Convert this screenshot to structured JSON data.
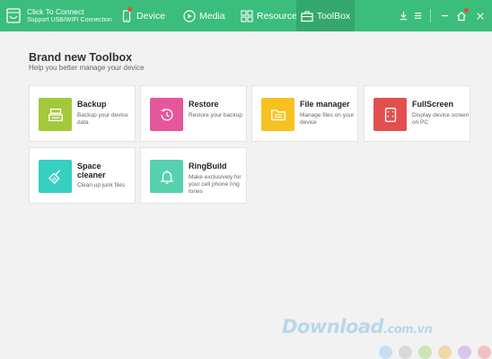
{
  "header": {
    "connect_title": "Click To Connect",
    "connect_subtitle": "Support USB/WIFI Connection",
    "tabs": [
      {
        "label": "Device",
        "icon": "phone-icon",
        "badge": true
      },
      {
        "label": "Media",
        "icon": "play-icon",
        "badge": false
      },
      {
        "label": "Resources",
        "icon": "grid-icon",
        "badge": false
      },
      {
        "label": "ToolBox",
        "icon": "toolbox-icon",
        "badge": false,
        "active": true
      }
    ],
    "controls": [
      "download-icon",
      "menu-icon",
      "minimize-icon",
      "home-icon",
      "close-icon"
    ]
  },
  "main": {
    "title": "Brand new Toolbox",
    "subtitle": "Help you better manage your device",
    "cards": [
      {
        "title": "Backup",
        "desc": "Backup your device data",
        "color": "#a3c93a",
        "icon": "backup-icon"
      },
      {
        "title": "Restore",
        "desc": "Restore your backup",
        "color": "#e5579d",
        "icon": "restore-icon"
      },
      {
        "title": "File manager",
        "desc": "Manage files on your device",
        "color": "#f6c21f",
        "icon": "folder-icon"
      },
      {
        "title": "FullScreen",
        "desc": "Display device screen on PC",
        "color": "#e14f4f",
        "icon": "fullscreen-icon"
      },
      {
        "title": "Space cleaner",
        "desc": "Clean up junk files",
        "color": "#36cfc2",
        "icon": "broom-icon"
      },
      {
        "title": "RingBuild",
        "desc": "Make exclusively for your cell phone ring tones",
        "color": "#56d1ae",
        "icon": "bell-icon"
      }
    ]
  },
  "watermark": {
    "text": "Download",
    "suffix": ".com.vn",
    "dot_colors": [
      "#c9dff0",
      "#d9d9d9",
      "#cfe3b6",
      "#f2d7a9",
      "#d5c8e6",
      "#f3c1c1"
    ]
  },
  "colors": {
    "header": "#3bbd7b",
    "header_active": "#34a86c",
    "background": "#f2f2f2"
  }
}
